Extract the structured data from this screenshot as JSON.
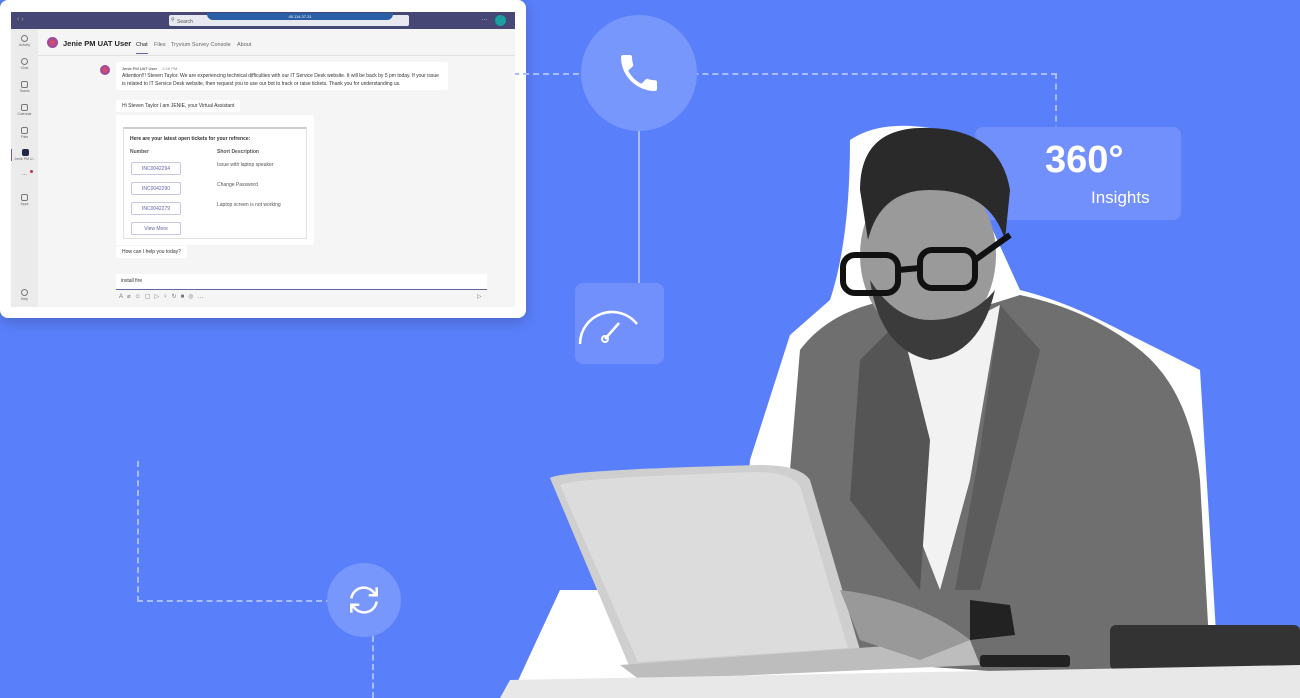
{
  "colors": {
    "background": "#5a7ffb",
    "teams_purple": "#464775",
    "accent": "#6264a7"
  },
  "insights": {
    "value": "360°",
    "label": "Insights"
  },
  "icons": [
    "phone-icon",
    "gauge-icon",
    "refresh-icon"
  ],
  "teams": {
    "titlebar": {
      "address": "40.114.37.21",
      "search_placeholder": "Search"
    },
    "rail": [
      {
        "label": "Activity"
      },
      {
        "label": "Chat"
      },
      {
        "label": "Teams"
      },
      {
        "label": "Calendar"
      },
      {
        "label": "Files"
      },
      {
        "label": "Jenie PM U..."
      },
      {
        "label": "..."
      },
      {
        "label": "Apps"
      },
      {
        "label": "Help"
      }
    ],
    "header": {
      "title": "Jenie PM UAT User",
      "tabs": [
        "Chat",
        "Files",
        "Tryvium Survey Console",
        "About"
      ]
    },
    "message": {
      "sender": "Jenie PM UAT User",
      "time": "2:16 PM",
      "text": "Attention!!! Steven Taylor. We are experiencing technical difficulties with our IT Service Desk website. It will be back by 5 pm today. If your issue is related to IT Service Desk website, then request you to use our bot to track or raise tickets. Thank you for understanding us."
    },
    "greeting": "Hi Steven Taylor I am JENIE, your Virtual Assistant",
    "card": {
      "title": "Here are your latest open tickets for your refrence:",
      "col_number": "Number",
      "col_desc": "Short Description",
      "tickets": [
        {
          "number": "INC0042294",
          "desc": "Issue with laptop speaker"
        },
        {
          "number": "INC0042290",
          "desc": "Change Password"
        },
        {
          "number": "INC0042279",
          "desc": "Laptop screen is not working"
        }
      ],
      "view_more": "View More"
    },
    "prompt": "How can I help you today?",
    "compose": {
      "value": "install fire"
    }
  }
}
